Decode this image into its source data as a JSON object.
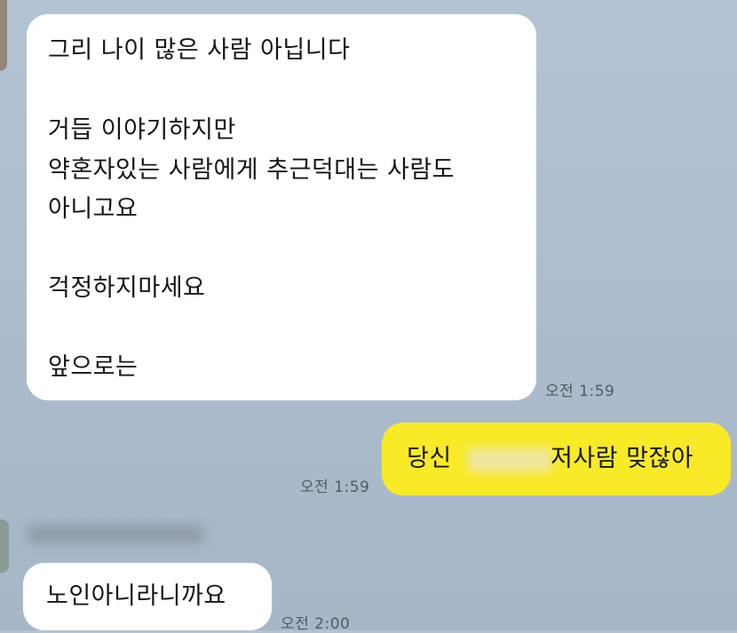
{
  "messages": [
    {
      "direction": "incoming",
      "lines": [
        "그리 나이 많은 사람 아닙니다",
        "",
        "거듭 이야기하지만",
        "약혼자있는 사람에게 추근덕대는 사람도",
        "아니고요",
        "",
        "걱정하지마세요",
        "",
        "앞으로는"
      ],
      "time": "오전 1:59"
    },
    {
      "direction": "outgoing",
      "text_before": "당신",
      "text_after": "저사람 맞잖아",
      "time": "오전 1:59"
    },
    {
      "direction": "incoming",
      "text": "노인아니라니까요",
      "time": "오전 2:00"
    }
  ],
  "colors": {
    "background": "#adbecf",
    "incoming_bubble": "#ffffff",
    "outgoing_bubble": "#f9ea28",
    "timestamp": "#515a64"
  }
}
